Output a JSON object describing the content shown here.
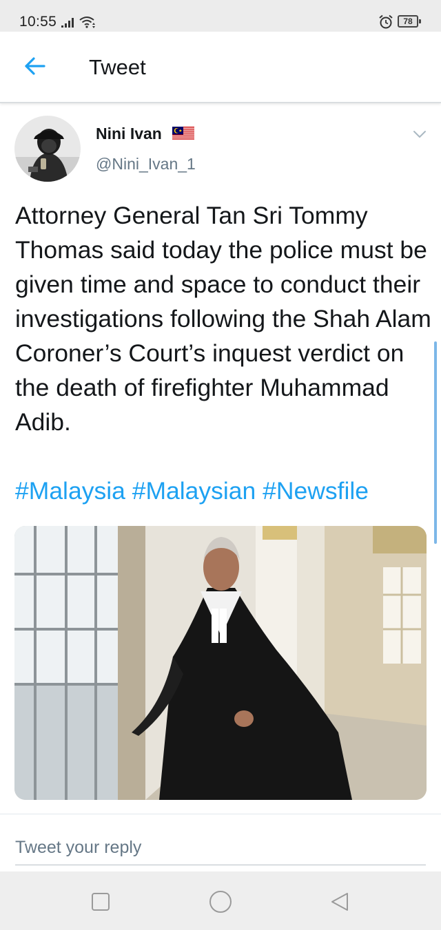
{
  "status_bar": {
    "time": "10:55",
    "battery": "78",
    "icons": [
      "signal-icon",
      "wifi-icon",
      "alarm-icon",
      "battery-icon"
    ]
  },
  "header": {
    "back_icon": "arrow-left-icon",
    "title": "Tweet"
  },
  "tweet": {
    "display_name": "Nini Ivan",
    "username": "@Nini_Ivan_1",
    "name_flag_icon": "malaysia-flag-icon",
    "menu_icon": "chevron-down-icon",
    "text": "Attorney General Tan Sri Tommy Thomas said today the police must be given time and space to conduct their investigations following the Shah Alam Coroner’s Court’s inquest verdict on the death of firefighter Muhammad Adib.",
    "hashtags": [
      "#Malaysia",
      "#Malaysian",
      "#Newsfile"
    ]
  },
  "reply": {
    "placeholder": "Tweet your reply"
  },
  "nav_bar": {
    "icons": [
      "recents-square-icon",
      "home-circle-icon",
      "back-triangle-icon"
    ]
  },
  "colors": {
    "accent": "#1da1f2",
    "text": "#14171a",
    "secondary_text": "#657786"
  }
}
